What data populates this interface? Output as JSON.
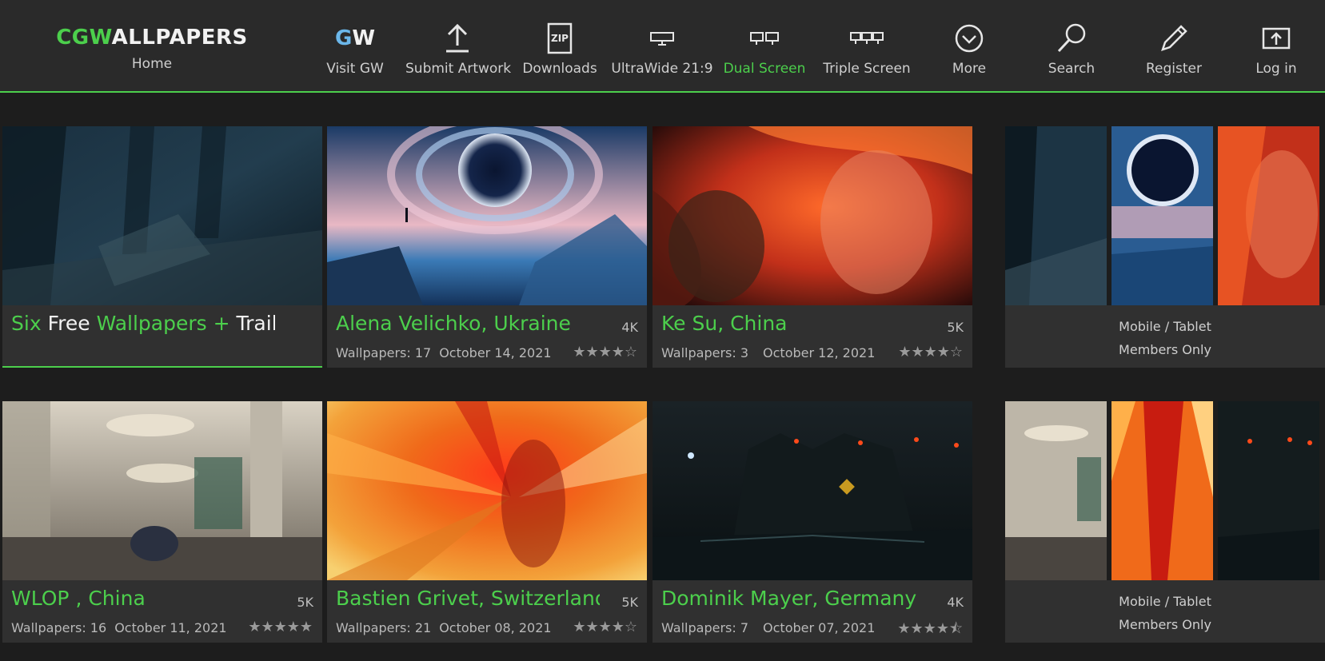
{
  "nav": {
    "logo_prefix": "CGW",
    "logo_suffix": "ALLPAPERS",
    "home": "Home",
    "gw_icon_g": "G",
    "gw_icon_w": "W",
    "zip_icon_text": "ZIP",
    "items": [
      {
        "label": "Visit GW",
        "icon": "gw-logo-icon"
      },
      {
        "label": "Submit Artwork",
        "icon": "upload-icon"
      },
      {
        "label": "Downloads",
        "icon": "zip-icon"
      },
      {
        "label": "UltraWide 21:9",
        "icon": "monitor-icon"
      },
      {
        "label": "Dual Screen",
        "icon": "dual-monitor-icon",
        "active": true
      },
      {
        "label": "Triple Screen",
        "icon": "triple-monitor-icon"
      },
      {
        "label": "More",
        "icon": "chevron-circle-icon"
      },
      {
        "label": "Search",
        "icon": "search-icon"
      },
      {
        "label": "Register",
        "icon": "pencil-icon"
      },
      {
        "label": "Log in",
        "icon": "login-icon"
      }
    ]
  },
  "colors": {
    "accent": "#4ccf4c",
    "bg": "#1d1d1d",
    "panel": "#303030",
    "nav": "#2a2a2a"
  },
  "cards": [
    {
      "title_parts": [
        "Six",
        "Free",
        "Wallpapers +",
        "Trail..."
      ],
      "res": "",
      "featured": true
    },
    {
      "title": "Alena Velichko, Ukraine",
      "res": "4K",
      "wallpapers": "Wallpapers: 17",
      "date": "October 14, 2021",
      "rating": 4
    },
    {
      "title": "Ke Su, China",
      "res": "5K",
      "wallpapers": "Wallpapers: 3",
      "date": "October 12, 2021",
      "rating": 4
    },
    {
      "title": "WLOP , China",
      "res": "5K",
      "wallpapers": "Wallpapers: 16",
      "date": "October 11, 2021",
      "rating": 5
    },
    {
      "title": "Bastien Grivet, Switzerland",
      "res": "5K",
      "wallpapers": "Wallpapers: 21",
      "date": "October 08, 2021",
      "rating": 4
    },
    {
      "title": "Dominik Mayer, Germany",
      "res": "4K",
      "wallpapers": "Wallpapers: 7",
      "date": "October 07, 2021",
      "rating": 4.5
    }
  ],
  "mobile": {
    "line1": "Mobile / Tablet",
    "line2": "Members Only"
  },
  "stars": {
    "four": "★★★★☆",
    "five": "★★★★★",
    "four_half": "★★★★⯪"
  }
}
